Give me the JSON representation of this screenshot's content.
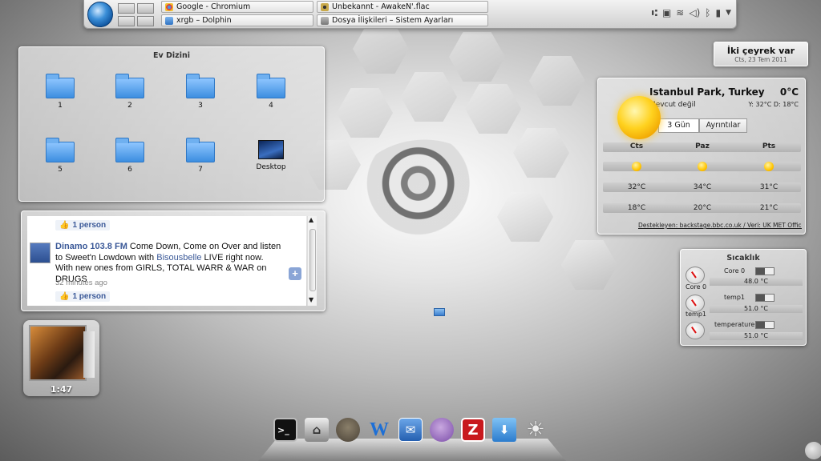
{
  "taskbar": {
    "tasks": [
      {
        "label": "Google - Chromium",
        "icon": "chromium-icon"
      },
      {
        "label": "xrgb – Dolphin",
        "icon": "dolphin-icon"
      },
      {
        "label": "Unbekannt - AwakeN'.flac",
        "icon": "audio-player-icon"
      },
      {
        "label": "Dosya İlişkileri – Sistem Ayarları",
        "icon": "system-settings-icon"
      }
    ],
    "tray_icons": [
      "klipper-icon",
      "clipboard-icon",
      "wifi-icon",
      "volume-icon",
      "bluetooth-icon",
      "battery-icon",
      "tray-expand-icon"
    ]
  },
  "folder_view": {
    "title": "Ev Dizini",
    "items": [
      {
        "label": "1",
        "type": "folder"
      },
      {
        "label": "2",
        "type": "folder"
      },
      {
        "label": "3",
        "type": "folder"
      },
      {
        "label": "4",
        "type": "folder"
      },
      {
        "label": "5",
        "type": "folder"
      },
      {
        "label": "6",
        "type": "folder"
      },
      {
        "label": "7",
        "type": "folder"
      },
      {
        "label": "Desktop",
        "type": "desktop"
      }
    ]
  },
  "feed": {
    "top_like": "1 person",
    "post": {
      "author": "Dinamo 103.8 FM",
      "text_before": " Come Down, Come on Over and listen to Sweet'n Lowdown with ",
      "mention": "Bisousbelle",
      "text_after": " LIVE right now. With new ones from GIRLS, TOTAL WARR & WAR on DRUGS",
      "time": "32 minutes ago",
      "like": "1 person"
    },
    "plus_label": "+"
  },
  "clock": {
    "time": "İki çeyrek var",
    "date": "Cts, 23 Tem 2011"
  },
  "weather": {
    "location": "Istanbul Park, Turkey",
    "current_temp": "0°C",
    "condition": "Mevcut değil",
    "hilo": "Y: 32°C D: 18°C",
    "tabs": [
      "3 Gün",
      "Ayrıntılar"
    ],
    "days": [
      {
        "name": "Cts",
        "high": "32°C",
        "low": "18°C"
      },
      {
        "name": "Paz",
        "high": "34°C",
        "low": "20°C"
      },
      {
        "name": "Pts",
        "high": "31°C",
        "low": "21°C"
      }
    ],
    "credit": "Destekleyen: backstage.bbc.co.uk / Veri: UK MET Office"
  },
  "sensors": {
    "title": "Sıcaklık",
    "rows": [
      {
        "name": "Core 0",
        "gauge_label": "Core 0",
        "value": "48.0 °C",
        "level": 0.48
      },
      {
        "name": "temp1",
        "gauge_label": "temp1",
        "value": "51.0 °C",
        "level": 0.51
      },
      {
        "name": "temperature",
        "gauge_label": "",
        "value": "51.0 °C",
        "level": 0.51
      }
    ]
  },
  "player": {
    "elapsed": "1:47"
  },
  "dock": {
    "items": [
      "terminal-icon",
      "home-folder-icon",
      "gimp-icon",
      "word-processor-icon",
      "mail-icon",
      "pidgin-icon",
      "filezilla-icon",
      "installer-icon",
      "settings-sun-icon"
    ],
    "filezilla_glyph": "Z",
    "word_glyph": "W"
  }
}
